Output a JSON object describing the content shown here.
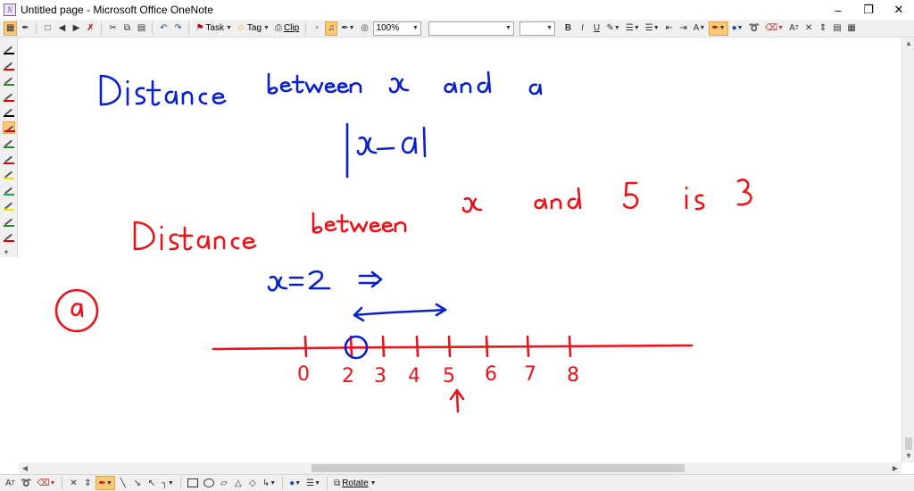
{
  "window": {
    "title": "Untitled page - Microsoft Office OneNote",
    "minimize": "–",
    "restore": "❐",
    "close": "✕"
  },
  "toolbar": {
    "task_label": "Task",
    "tag_label": "Tag",
    "clip_label": "Clip",
    "zoom_value": "100%",
    "font_value": "",
    "size_value": "",
    "bold": "B",
    "italic": "I",
    "underline": "U"
  },
  "drawbar": {
    "rotate_label": "Rotate"
  },
  "pen_colors": [
    "#000000",
    "#d40000",
    "#1a8f1a",
    "#d40000",
    "#000000",
    "#d40000",
    "#1a8f1a",
    "#d40000",
    "#f5e400",
    "#00b050",
    "#f5e400",
    "#1a8f1a",
    "#d40000"
  ],
  "ink": {
    "blue": "#0a20c8",
    "red": "#e8141c",
    "number_line_labels": [
      "0",
      "2",
      "3",
      "4",
      "5",
      "6",
      "7",
      "8"
    ]
  }
}
